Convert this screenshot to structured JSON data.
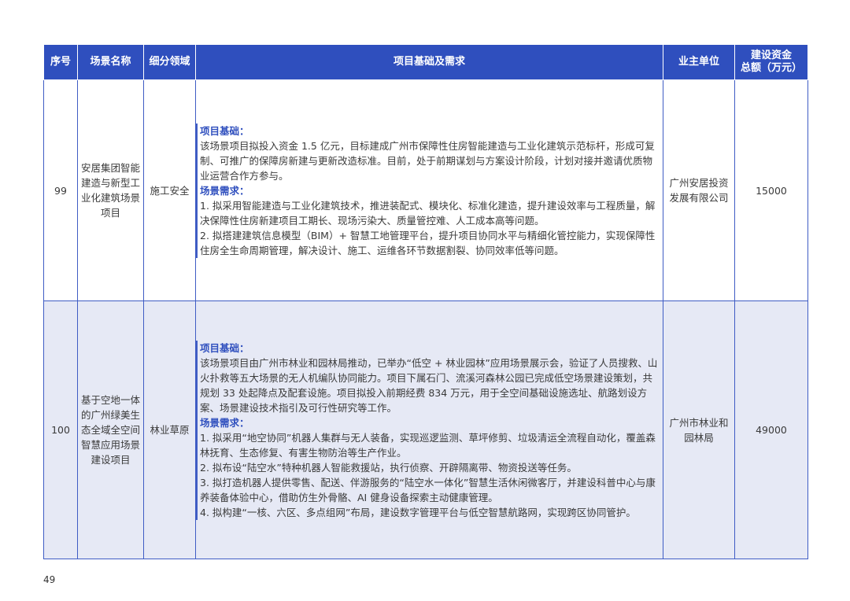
{
  "table": {
    "headers": {
      "seq": "序号",
      "scene": "场景名称",
      "field": "细分领域",
      "detail": "项目基础及需求",
      "owner": "业主单位",
      "amount_line1": "建设资金",
      "amount_line2": "总额（万元）"
    },
    "rows": [
      {
        "seq": "99",
        "scene": "安居集团智能建造与新型工业化建筑场景项目",
        "field": "施工安全",
        "basis_title": "项目基础：",
        "basis": "该场景项目拟投入资金 1.5 亿元，目标建成广州市保障性住房智能建造与工业化建筑示范标杆，形成可复制、可推广的保障房新建与更新改造标准。目前，处于前期谋划与方案设计阶段，计划对接并邀请优质物业运营合作方参与。",
        "needs_title": "场景需求：",
        "needs": [
          "1. 拟采用智能建造与工业化建筑技术，推进装配式、模块化、标准化建造，提升建设效率与工程质量，解决保障性住房新建项目工期长、现场污染大、质量管控难、人工成本高等问题。",
          "2. 拟搭建建筑信息模型（BIM）+ 智慧工地管理平台，提升项目协同水平与精细化管控能力，实现保障性住房全生命周期管理，解决设计、施工、运维各环节数据割裂、协同效率低等问题。"
        ],
        "owner": "广州安居投资发展有限公司",
        "amount": "15000"
      },
      {
        "seq": "100",
        "scene": "基于空地一体的广州绿美生态全域全空间智慧应用场景建设项目",
        "field": "林业草原",
        "basis_title": "项目基础：",
        "basis": "该场景项目由广州市林业和园林局推动，已举办“低空 + 林业园林”应用场景展示会，验证了人员搜救、山火扑救等五大场景的无人机编队协同能力。项目下属石门、流溪河森林公园已完成低空场景建设策划，共规划 33 处起降点及配套设施。项目拟投入前期经费 834 万元，用于全空间基础设施选址、航路划设方案、场景建设技术指引及可行性研究等工作。",
        "needs_title": "场景需求：",
        "needs": [
          "1. 拟采用“地空协同”机器人集群与无人装备，实现巡逻监测、草坪修剪、垃圾清运全流程自动化，覆盖森林抚育、生态修复、有害生物防治等生产作业。",
          "2. 拟布设“陆空水”特种机器人智能救援站，执行侦察、开辟隔离带、物资投送等任务。",
          "3. 拟打造机器人提供零售、配送、伴游服务的“陆空水一体化”智慧生活休闲微客厅，并建设科普中心与康养装备体验中心，借助仿生外骨骼、AI 健身设备探索主动健康管理。",
          "4. 拟构建“一核、六区、多点组网”布局，建设数字管理平台与低空智慧航路网，实现跨区协同管护。"
        ],
        "owner": "广州市林业和园林局",
        "amount": "49000"
      }
    ]
  },
  "page_number": "49"
}
